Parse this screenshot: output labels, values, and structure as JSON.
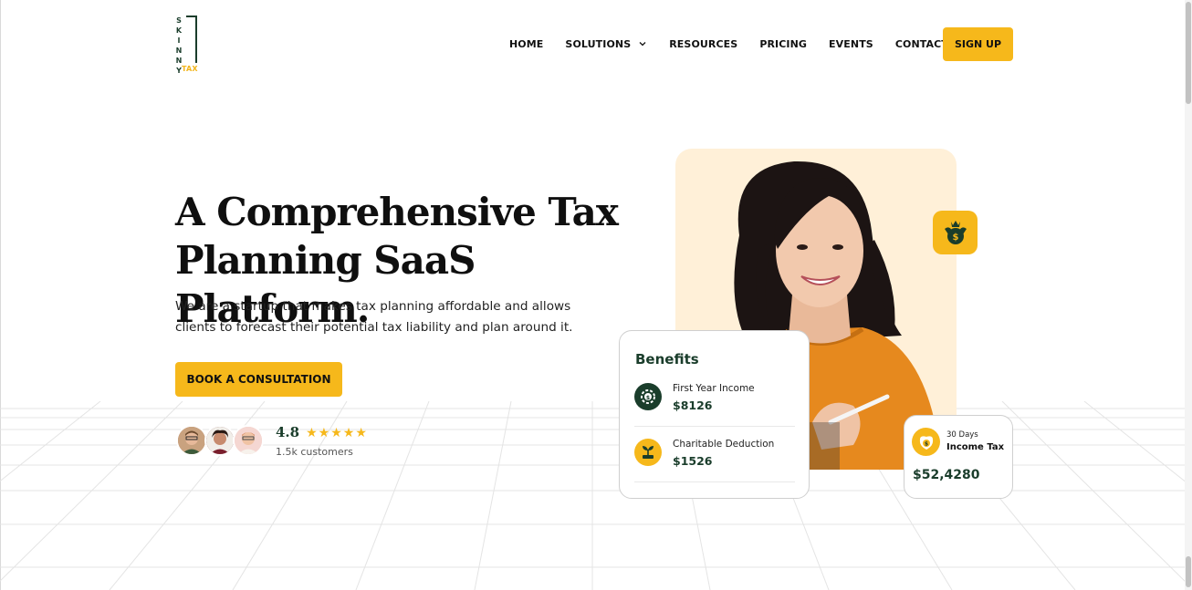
{
  "logo": {
    "letters": [
      "S",
      "K",
      "I",
      "N",
      "N",
      "Y"
    ],
    "suffix": "TAX"
  },
  "nav": {
    "items": [
      {
        "label": "HOME"
      },
      {
        "label": "SOLUTIONS"
      },
      {
        "label": "RESOURCES"
      },
      {
        "label": "PRICING"
      },
      {
        "label": "EVENTS"
      },
      {
        "label": "CONTACT"
      }
    ],
    "signup_label": "SIGN UP"
  },
  "hero": {
    "title_line1": "A Comprehensive Tax",
    "title_line2": "Planning SaaS Platform.",
    "subtitle_line1": "We are a startup that makes tax planning affordable and allows",
    "subtitle_line2": "clients to forecast their potential tax liability and plan around it.",
    "cta_label": "BOOK A CONSULTATION",
    "rating": "4.8",
    "stars": 5,
    "customers": "1.5k customers"
  },
  "benefits": {
    "title": "Benefits",
    "items": [
      {
        "label": "First Year Income",
        "value": "$8126"
      },
      {
        "label": "Charitable Deduction",
        "value": "$1526"
      }
    ]
  },
  "income_tax": {
    "days": "30 Days",
    "label": "Income Tax",
    "value": "$52,4280"
  },
  "colors": {
    "accent": "#f6b81b",
    "brand_green": "#1a3d2b",
    "panel_bg": "#fff0d8"
  }
}
